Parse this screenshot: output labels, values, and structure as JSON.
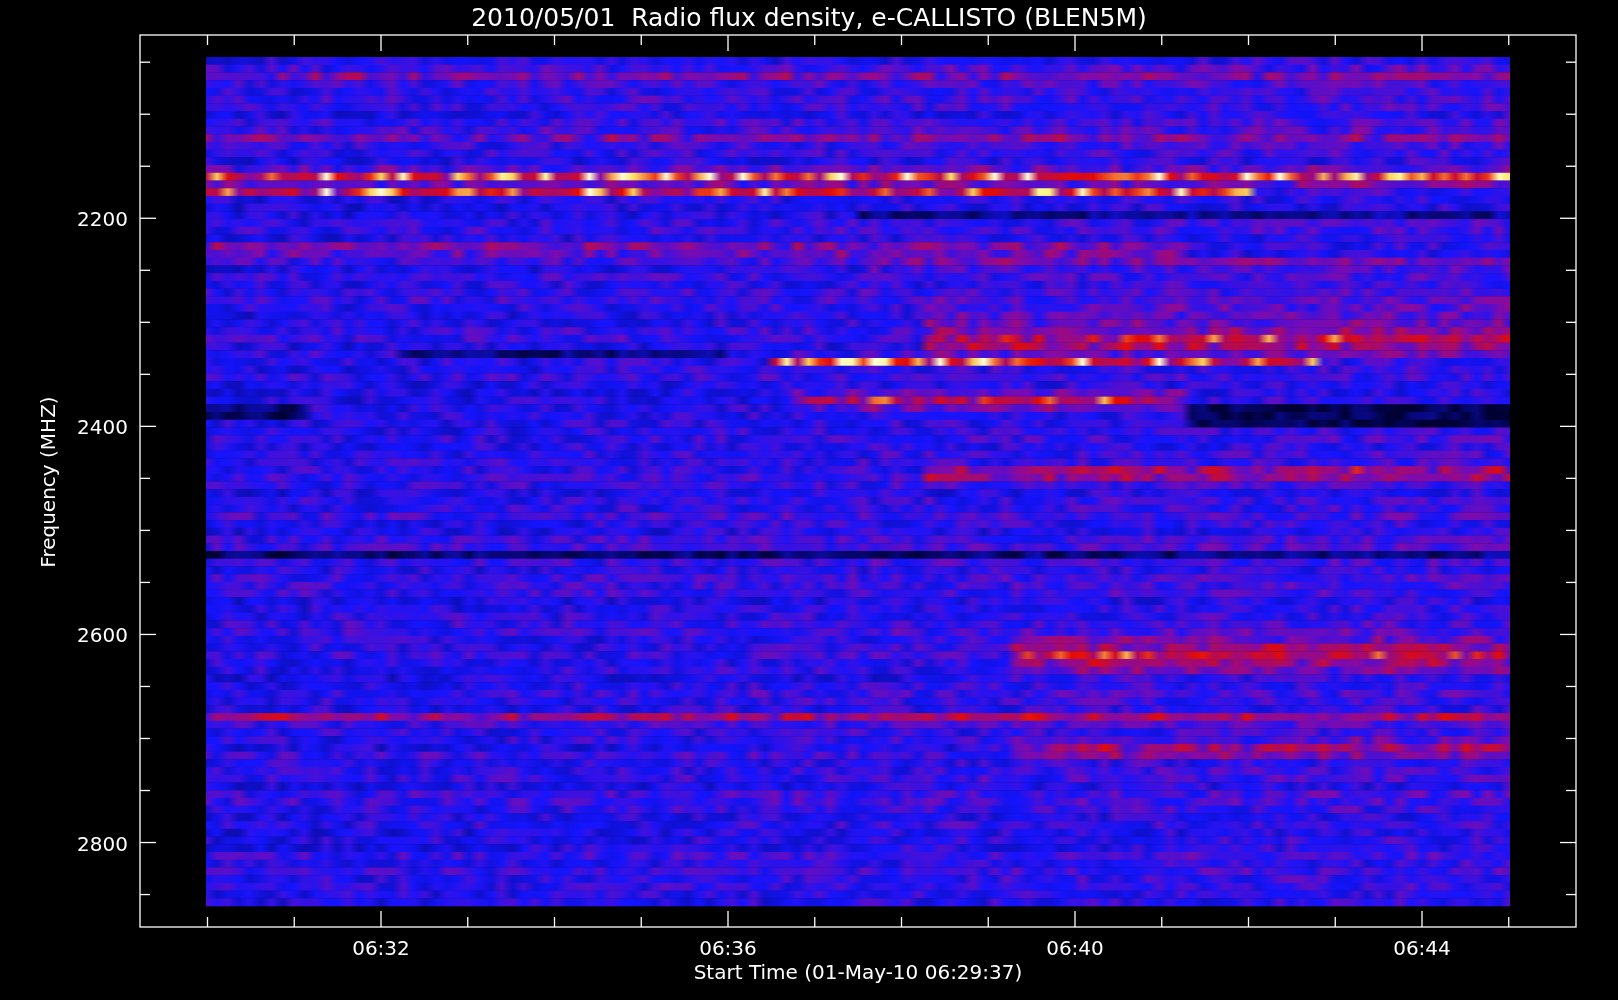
{
  "title": "2010/05/01  Radio flux density, e-CALLISTO (BLEN5M)",
  "y_axis": {
    "label": "Frequency (MHZ)",
    "ticks": [
      "2200",
      "2400",
      "2600",
      "2800"
    ]
  },
  "x_axis": {
    "label": "Start Time (01-May-10 06:29:37)",
    "ticks": [
      "06:32",
      "06:36",
      "06:40",
      "06:44"
    ]
  }
}
